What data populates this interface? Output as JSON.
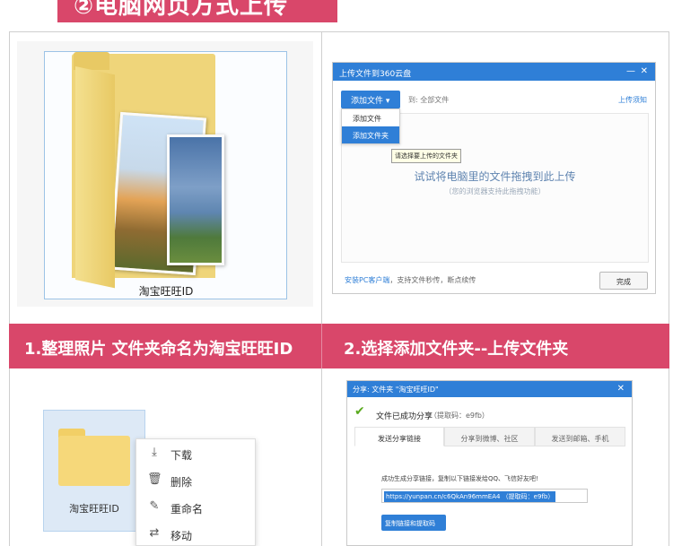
{
  "header": {
    "title": "②电脑网页方式上传"
  },
  "captions": {
    "step1": "1.整理照片  文件夹命名为淘宝旺旺ID",
    "step2": "2.选择添加文件夹--上传文件夹"
  },
  "panel1": {
    "folder_label": "淘宝旺旺ID"
  },
  "upload_dialog": {
    "title": "上传文件到360云盘",
    "minimize": "—",
    "close": "✕",
    "add_button": "添加文件 ▾",
    "to_label": "到: 全部文件",
    "help_link": "上传须知",
    "menu_items": [
      "添加文件",
      "添加文件夹"
    ],
    "tooltip": "请选择要上传的文件夹",
    "drop_main": "试试将电脑里的文件拖拽到此上传",
    "drop_sub": "（您的浏览器支持此拖拽功能）",
    "footer_link": "安装PC客户端",
    "footer_text": "，支持文件秒传，断点续传",
    "done_button": "完成"
  },
  "panel3": {
    "folder_label": "淘宝旺旺ID",
    "context_menu": [
      {
        "icon": "download-icon",
        "glyph": "⤓",
        "label": "下载"
      },
      {
        "icon": "trash-icon",
        "glyph": "🗑",
        "label": "删除"
      },
      {
        "icon": "edit-icon",
        "glyph": "✎",
        "label": "重命名"
      },
      {
        "icon": "move-icon",
        "glyph": "⇄",
        "label": "移动"
      }
    ]
  },
  "share_dialog": {
    "title": "分享: 文件夹 \"淘宝旺旺ID\"",
    "close": "✕",
    "success_text": "文件已成功分享",
    "code_text": "（提取码：e9fb）",
    "tabs": [
      "发送分享链接",
      "分享到微博、社区",
      "发送到邮箱、手机"
    ],
    "description": "成功生成分享链接，复制以下链接发给QQ、飞信好友吧!",
    "link": "https://yunpan.cn/c6QkAn96mmEA4 （提取码：e9fb）",
    "copy_button": "复制链接和提取码"
  },
  "colors": {
    "accent": "#d9476a",
    "blue": "#2f7fd7"
  }
}
